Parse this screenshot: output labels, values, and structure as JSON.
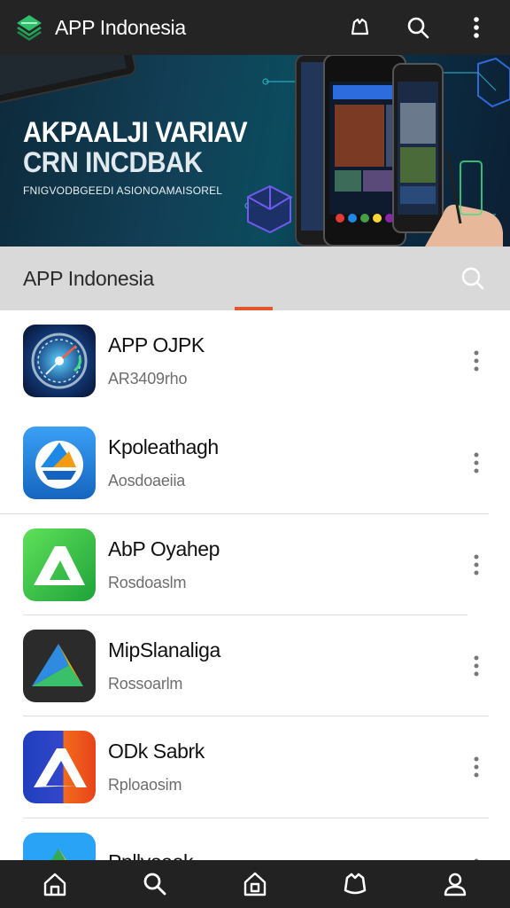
{
  "header": {
    "title": "APP Indonesia",
    "logo_icon": "green-layers-logo-icon",
    "actions": [
      {
        "name": "notifications-icon"
      },
      {
        "name": "search-icon"
      },
      {
        "name": "more-vert-icon"
      }
    ]
  },
  "banner": {
    "headline_line1": "AKPAALJI VARIAV",
    "headline_line2": "CRN INCDBAK",
    "tagline": "FNIGVODBGEEDI ASIONOAMAISOREL"
  },
  "section": {
    "title": "APP Indonesia",
    "accent_color": "#e2572b"
  },
  "apps": [
    {
      "name": "APP OJPK",
      "subtitle": "AR3409rho",
      "icon": "compass-app-icon"
    },
    {
      "name": "Kpoleathagh",
      "subtitle": "Aosdoaeiia",
      "icon": "blue-arrow-circle-app-icon"
    },
    {
      "name": "AbP Oyahep",
      "subtitle": "Rosdoaslm",
      "icon": "green-triangle-app-icon"
    },
    {
      "name": "MipSlanaliga",
      "subtitle": "Rossoarlm",
      "icon": "dark-triangle-app-icon"
    },
    {
      "name": "ODk Sabrk",
      "subtitle": "Rploaosim",
      "icon": "orange-blue-triangle-app-icon"
    },
    {
      "name": "Ppllyoaok",
      "subtitle": "",
      "icon": "drive-app-icon"
    }
  ],
  "bottom_nav": [
    {
      "name": "home-icon"
    },
    {
      "name": "search-icon"
    },
    {
      "name": "store-icon"
    },
    {
      "name": "chat-icon"
    },
    {
      "name": "profile-icon"
    }
  ]
}
